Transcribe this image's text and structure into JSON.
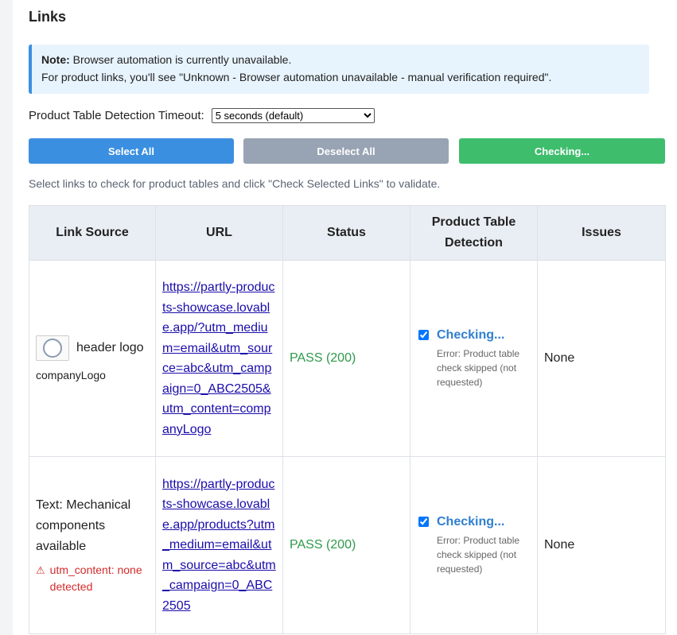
{
  "section_title": "Links",
  "note": {
    "label": "Note:",
    "line1": "Browser automation is currently unavailable.",
    "line2": "For product links, you'll see \"Unknown - Browser automation unavailable - manual verification required\"."
  },
  "timeout": {
    "label": "Product Table Detection Timeout:",
    "selected": "5 seconds (default)"
  },
  "buttons": {
    "select_all": "Select All",
    "deselect_all": "Deselect All",
    "checking": "Checking..."
  },
  "helper_text": "Select links to check for product tables and click \"Check Selected Links\" to validate.",
  "table": {
    "headers": [
      "Link Source",
      "URL",
      "Status",
      "Product Table Detection",
      "Issues"
    ],
    "rows": [
      {
        "source_label": "header logo",
        "source_sub": "companyLogo",
        "url": "https://partly-products-showcase.lovable.app/?utm_medium=email&utm_source=abc&utm_campaign=0_ABC2505&utm_content=companyLogo",
        "status": "PASS (200)",
        "detection_status": "Checking...",
        "detection_error": "Error: Product table check skipped (not requested)",
        "issues": "None"
      },
      {
        "source_text": "Text: Mechanical components available",
        "warning": "utm_content: none detected",
        "url": "https://partly-products-showcase.lovable.app/products?utm_medium=email&utm_source=abc&utm_campaign=0_ABC2505",
        "status": "PASS (200)",
        "detection_status": "Checking...",
        "detection_error": "Error: Product table check skipped (not requested)",
        "issues": "None"
      }
    ]
  },
  "icons": {
    "warning": "warning-icon",
    "logo": "company-logo-image"
  },
  "colors": {
    "primary": "#3b8fe0",
    "secondary": "#98a3b3",
    "success": "#3ebd6c",
    "pass_text": "#2e9a4a",
    "warning_text": "#d42a2a",
    "note_bg": "#e8f4fd"
  }
}
